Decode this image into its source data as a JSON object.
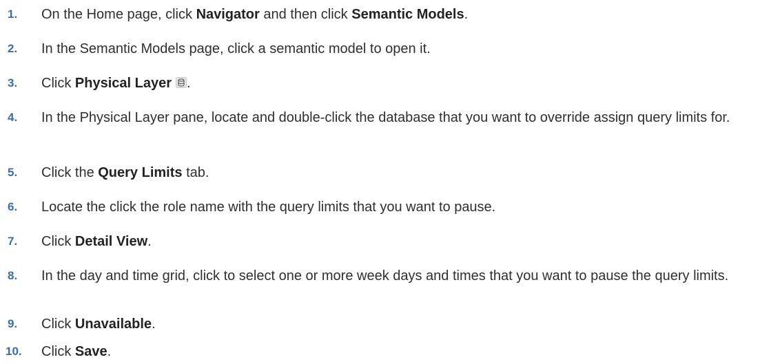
{
  "steps": [
    {
      "num": "1.",
      "parts": [
        {
          "t": "On the Home page, click "
        },
        {
          "t": "Navigator",
          "b": true
        },
        {
          "t": " and then click "
        },
        {
          "t": "Semantic Models",
          "b": true
        },
        {
          "t": "."
        }
      ]
    },
    {
      "num": "2.",
      "parts": [
        {
          "t": "In the Semantic Models page, click a semantic model to open it."
        }
      ]
    },
    {
      "num": "3.",
      "parts": [
        {
          "t": "Click "
        },
        {
          "t": "Physical Layer",
          "b": true
        },
        {
          "icon": "database-icon"
        },
        {
          "t": "."
        }
      ]
    },
    {
      "num": "4.",
      "parts": [
        {
          "t": "In the Physical Layer pane, locate and double-click the database that you want to override assign query limits for."
        }
      ]
    },
    {
      "num": "5.",
      "parts": [
        {
          "t": "Click the "
        },
        {
          "t": "Query Limits",
          "b": true
        },
        {
          "t": " tab."
        }
      ]
    },
    {
      "num": "6.",
      "parts": [
        {
          "t": "Locate the click the role name with the query limits that you want to pause."
        }
      ]
    },
    {
      "num": "7.",
      "parts": [
        {
          "t": "Click "
        },
        {
          "t": "Detail View",
          "b": true
        },
        {
          "t": "."
        }
      ]
    },
    {
      "num": "8.",
      "parts": [
        {
          "t": "In the day and time grid, click to select one or more week days and times that you want to pause the query limits."
        }
      ]
    },
    {
      "num": "9.",
      "parts": [
        {
          "t": "Click "
        },
        {
          "t": "Unavailable",
          "b": true
        },
        {
          "t": "."
        }
      ]
    },
    {
      "num": "10.",
      "parts": [
        {
          "t": "Click "
        },
        {
          "t": "Save",
          "b": true
        },
        {
          "t": "."
        }
      ]
    }
  ]
}
